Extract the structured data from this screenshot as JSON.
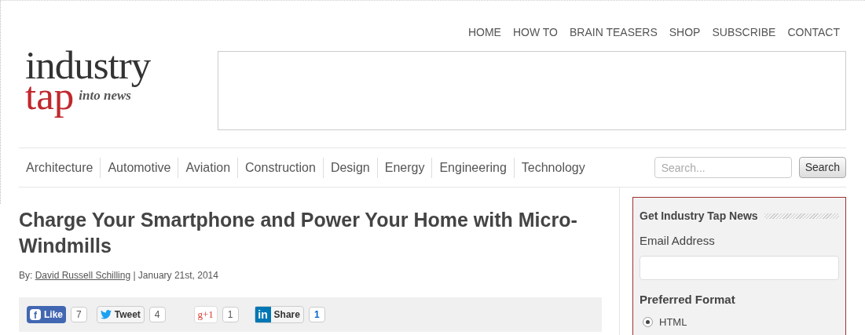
{
  "top_nav": [
    "HOME",
    "HOW TO",
    "BRAIN TEASERS",
    "SHOP",
    "SUBSCRIBE",
    "CONTACT"
  ],
  "logo": {
    "word_1": "industry",
    "word_2": "tap",
    "tagline": "into news"
  },
  "categories": [
    "Architecture",
    "Automotive",
    "Aviation",
    "Construction",
    "Design",
    "Energy",
    "Engineering",
    "Technology"
  ],
  "search": {
    "placeholder": "Search...",
    "button": "Search"
  },
  "article": {
    "title": "Charge Your Smartphone and Power Your Home with Micro-Windmills",
    "by": "By:",
    "author": "David Russell Schilling",
    "date": "| January 21st, 2014"
  },
  "share": [
    {
      "kind": "facebook",
      "glyph": "f",
      "label": "Like",
      "count": "7"
    },
    {
      "kind": "twitter",
      "label": "Tweet",
      "count": "4"
    },
    {
      "kind": "gplus",
      "label": "g+1",
      "count": "1"
    },
    {
      "kind": "linkedin",
      "glyph": "in",
      "label": "Share",
      "count": "1"
    }
  ],
  "newsletter": {
    "title": "Get Industry Tap News",
    "email_label": "Email Address",
    "format_label": "Preferred Format",
    "options": [
      {
        "label": "HTML",
        "selected": true
      }
    ]
  }
}
